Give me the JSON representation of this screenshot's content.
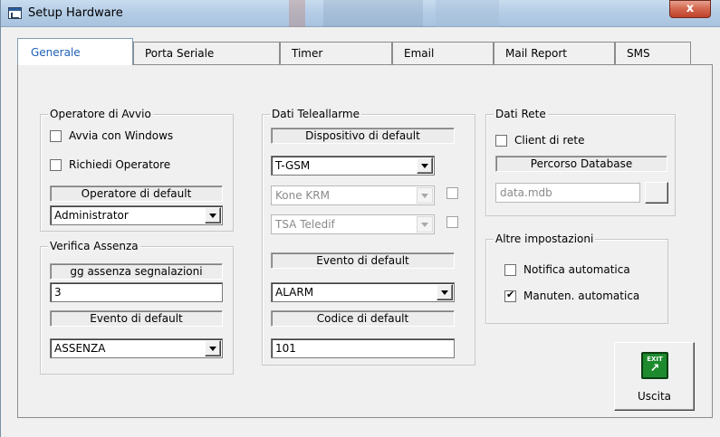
{
  "window": {
    "title": "Setup Hardware",
    "close_label": "x"
  },
  "tabs": [
    "Generale",
    "Porta Seriale",
    "Timer",
    "Email",
    "Mail Report",
    "SMS"
  ],
  "operatore_avvio": {
    "legend": "Operatore di Avvio",
    "avvia_windows": "Avvia con Windows",
    "richiedi_operatore": "Richiedi Operatore",
    "default_label": "Operatore di default",
    "default_value": "Administrator"
  },
  "verifica_assenza": {
    "legend": "Verifica Assenza",
    "gg_label": "gg assenza segnalazioni",
    "gg_value": "3",
    "evento_label": "Evento di default",
    "evento_value": "ASSENZA"
  },
  "dati_teleallarme": {
    "legend": "Dati Teleallarme",
    "dispositivo_label": "Dispositivo di default",
    "dispositivo_value": "T-GSM",
    "disp2_value": "Kone KRM",
    "disp3_value": "TSA Teledif",
    "evento_label": "Evento di default",
    "evento_value": "ALARM",
    "codice_label": "Codice di default",
    "codice_value": "101"
  },
  "dati_rete": {
    "legend": "Dati Rete",
    "client_label": "Client di rete",
    "percorso_label": "Percorso Database",
    "percorso_value": "data.mdb"
  },
  "altre_impostazioni": {
    "legend": "Altre impostazioni",
    "notifica_label": "Notifica automatica",
    "manuten_label": "Manuten. automatica",
    "manuten_checked": true
  },
  "exit_button": {
    "icon_text": "EXIT",
    "label": "Uscita"
  },
  "colors": {
    "titlebar": "#b5cde6",
    "close": "#c0412a",
    "active_tab_text": "#2060b8",
    "exit_icon": "#1d8a2e"
  }
}
